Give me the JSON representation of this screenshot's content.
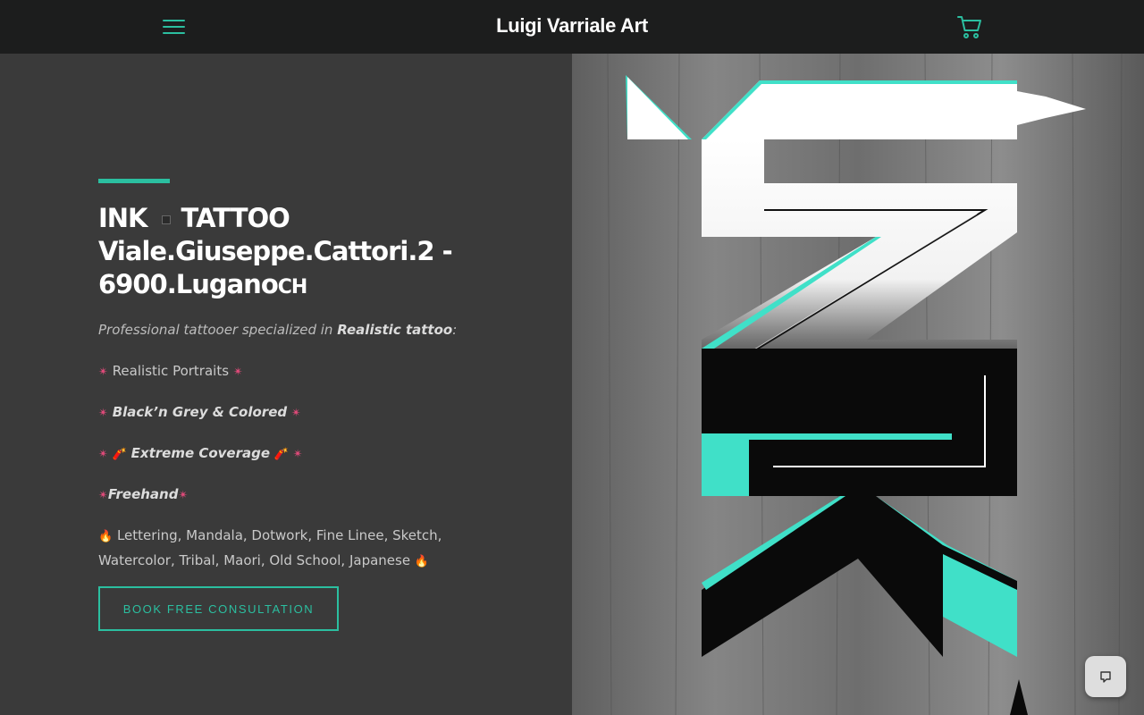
{
  "header": {
    "site_title": "Luigi Varriale Art",
    "menu_icon": "hamburger-menu-icon",
    "cart_icon": "shopping-cart-icon"
  },
  "hero": {
    "heading_line1_a": "INK",
    "heading_line1_b": "TATTOO",
    "heading_line2": "Viale.Giuseppe.Cattori.2 -",
    "heading_line3_a": "6900.Lugano",
    "heading_line3_b": "CH",
    "intro_prefix": "Professional tattooer specialized in ",
    "intro_bold": "Realistic tattoo",
    "intro_suffix": ":",
    "items": [
      "Realistic Portraits",
      "Black’n Grey & Colored",
      "Extreme Coverage",
      "Freehand"
    ],
    "styles_line1": "Lettering, Mandala, Dotwork, Fine Linee, Sketch,",
    "styles_line2": "Watercolor, Tribal, Maori, Old School, Japanese",
    "cta_label": "BOOK FREE CONSULTATION"
  },
  "chat": {
    "icon": "chat-bubble-icon"
  },
  "colors": {
    "accent": "#2bbfa0",
    "header_bg": "#1c1d1d",
    "panel_bg": "#3a3a3a"
  }
}
